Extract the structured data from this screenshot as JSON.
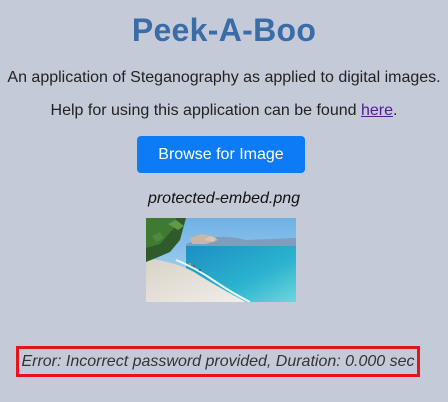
{
  "header": {
    "title": "Peek-A-Boo",
    "tagline": "An application of Steganography as applied to digital images."
  },
  "help": {
    "prefix": "Help for using this application can be found ",
    "link_text": "here",
    "suffix": "."
  },
  "browse_button": {
    "label": "Browse for Image",
    "color": "#0d7bf5"
  },
  "file": {
    "name": "protected-embed.png"
  },
  "status": {
    "message": "Error: Incorrect password provided, Duration: 0.000 sec",
    "border_color": "#e5141b"
  },
  "colors": {
    "background": "#c5cad9",
    "title": "#3a6ca8",
    "link": "#551a8b"
  }
}
